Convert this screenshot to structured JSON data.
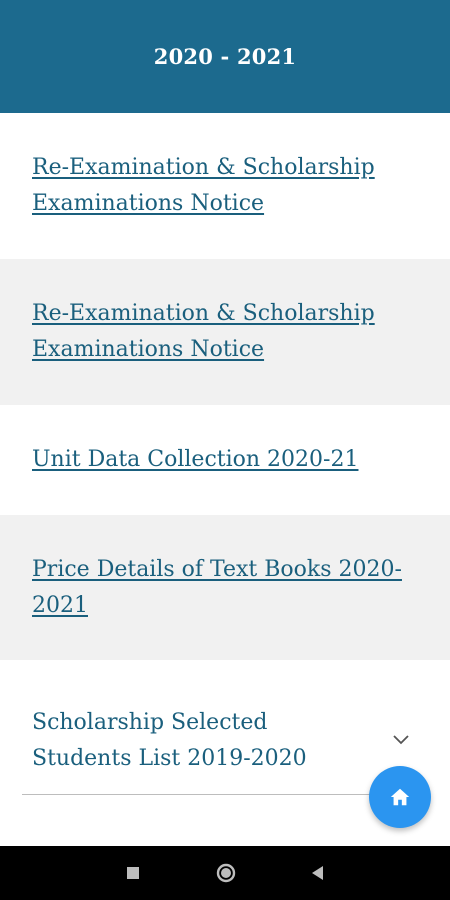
{
  "header": {
    "title": "2020 - 2021"
  },
  "notices": [
    {
      "label": "Re-Examination & Scholarship Examinations Notice"
    },
    {
      "label": "Re-Examination & Scholarship Examinations Notice"
    },
    {
      "label": "Unit Data Collection 2020-21"
    },
    {
      "label": "Price Details of Text Books 2020-2021"
    }
  ],
  "accordion": {
    "label": "Scholarship Selected Students List 2019-2020",
    "icon": "chevron-down-icon"
  },
  "fab": {
    "icon": "home-icon"
  },
  "navbar": {
    "recents_icon": "square-icon",
    "home_icon": "circle-icon",
    "back_icon": "triangle-back-icon"
  },
  "colors": {
    "header_bg": "#1c6a8e",
    "link": "#1a5f7d",
    "alt_row": "#f1f1f1",
    "fab": "#2b95f0"
  }
}
